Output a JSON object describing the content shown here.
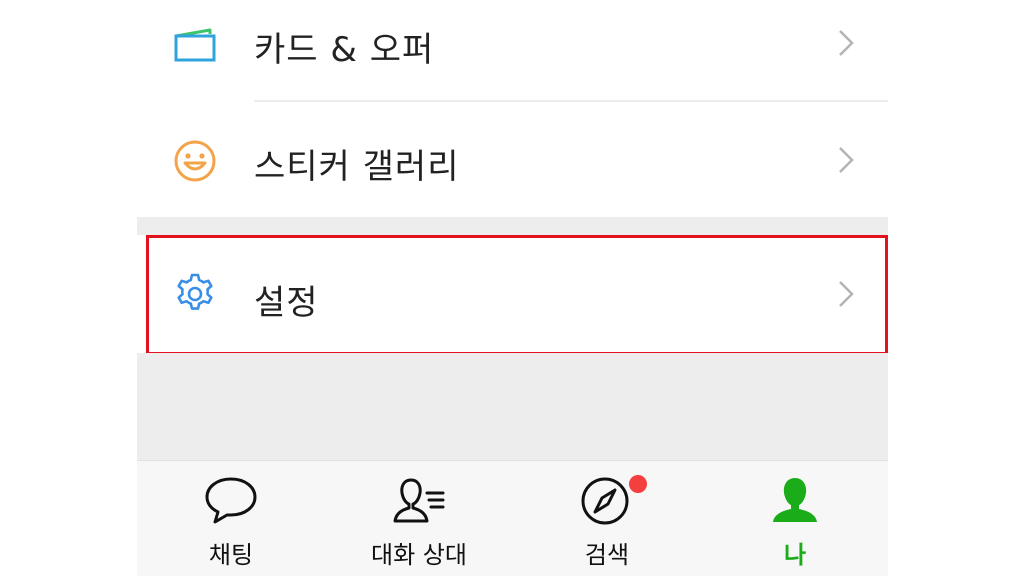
{
  "menu": {
    "items": [
      {
        "label": "카드 & 오퍼",
        "icon": "card-icon"
      },
      {
        "label": "스티커 갤러리",
        "icon": "sticker-smile-icon"
      },
      {
        "label": "설정",
        "icon": "gear-icon",
        "highlighted": true
      }
    ]
  },
  "tabbar": {
    "tabs": [
      {
        "label": "채팅",
        "icon": "chat-bubble-icon",
        "active": false
      },
      {
        "label": "대화 상대",
        "icon": "contacts-icon",
        "active": false
      },
      {
        "label": "검색",
        "icon": "compass-icon",
        "active": false,
        "badge": true
      },
      {
        "label": "나",
        "icon": "person-icon",
        "active": true
      }
    ]
  },
  "colors": {
    "highlight_border": "#e3101e",
    "active_tab": "#1aad19",
    "badge": "#f43f3f",
    "card_icon": "#2ea3de",
    "sticker_icon": "#f3a44a",
    "gear_icon": "#3b8ee6"
  }
}
